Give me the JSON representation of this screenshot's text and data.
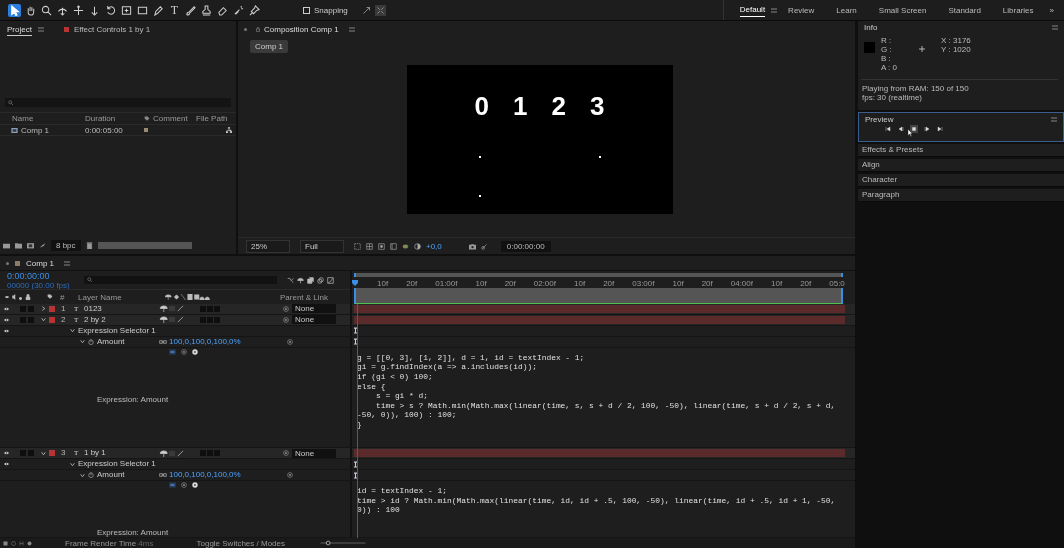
{
  "toolbar": {
    "tools": [
      {
        "kind": "select",
        "selected": true
      },
      {
        "kind": "hand",
        "selected": false
      },
      {
        "kind": "zoom",
        "selected": false
      },
      {
        "kind": "orbit",
        "selected": false
      },
      {
        "kind": "pan",
        "selected": false
      },
      {
        "kind": "dolly",
        "selected": false
      },
      {
        "kind": "rotate",
        "selected": false
      },
      {
        "kind": "behind",
        "selected": false
      },
      {
        "kind": "rect",
        "selected": false
      },
      {
        "kind": "pen",
        "selected": false
      },
      {
        "kind": "type",
        "glyph": "T",
        "selected": false
      },
      {
        "kind": "brush",
        "selected": false
      },
      {
        "kind": "stamp",
        "selected": false
      },
      {
        "kind": "eraser",
        "selected": false
      },
      {
        "kind": "roto",
        "selected": false
      },
      {
        "kind": "puppet",
        "selected": false
      }
    ],
    "snapping": {
      "label": "Snapping",
      "checked": false
    },
    "workspaces": [
      {
        "label": "Default",
        "selected": true
      },
      {
        "label": "Review",
        "selected": false
      },
      {
        "label": "Learn",
        "selected": false
      },
      {
        "label": "Small Screen",
        "selected": false
      },
      {
        "label": "Standard",
        "selected": false
      },
      {
        "label": "Libraries",
        "selected": false
      }
    ],
    "more": "»"
  },
  "project": {
    "tabs": [
      {
        "label": "Project",
        "selected": true
      },
      {
        "label": "Effect Controls 1 by 1",
        "selected": false,
        "color": "#b83434"
      }
    ],
    "columns": [
      "Name",
      "Duration",
      "Comment",
      "File Path"
    ],
    "items": [
      {
        "name": "Comp 1",
        "duration": "0:00:05:00"
      }
    ],
    "bit_depth": "8 bpc",
    "bar": {
      "level": 1
    }
  },
  "composition": {
    "tab": "Composition Comp 1",
    "breadcrumb": "Comp 1",
    "digits": [
      "0",
      "1",
      "2",
      "3"
    ],
    "zoom": "25%",
    "resolution": "Full",
    "exposure": "+0,0",
    "timecode": "0:00:00:00"
  },
  "timeline": {
    "tab": "Comp 1",
    "timecode": "0:00:00:00",
    "frame_info": "00000 (30.00 fps)",
    "columns": {
      "number": "#",
      "layer_name": "Layer Name",
      "parent": "Parent & Link"
    },
    "ruler": [
      "10f",
      "20f",
      "01:00f",
      "10f",
      "20f",
      "02:00f",
      "10f",
      "20f",
      "03:00f",
      "10f",
      "20f",
      "04:00f",
      "10f",
      "20f",
      "05:0"
    ],
    "rows": [
      {
        "kind": "layer",
        "number": "1",
        "glyph": "T",
        "name": "0123",
        "expanded": false,
        "solo": false,
        "locked": false,
        "frame_blend": false,
        "motion_blur": false,
        "adjustment": false,
        "parent": "None",
        "color": "#b83434"
      },
      {
        "kind": "layer",
        "number": "2",
        "glyph": "T",
        "name": "2 by 2",
        "expanded": true,
        "solo": false,
        "locked": false,
        "frame_blend": false,
        "motion_blur": false,
        "adjustment": false,
        "parent": "None",
        "color": "#b83434"
      },
      {
        "kind": "group",
        "name": "Expression Selector 1"
      },
      {
        "kind": "property",
        "name": "Amount",
        "value": "100,0,100,0,100,0%"
      },
      {
        "kind": "expression",
        "label": "Expression: Amount",
        "code": [
          "g = [[0, 3], [1, 2]], d = 1, id = textIndex - 1;",
          "gi = g.findIndex(a => a.includes(id));",
          "if (gi < 0) 100;",
          "else {",
          "    s = gi * d;",
          "    time > s ? Math.min(Math.max(linear(time, s, s + d / 2, 100, -50), linear(time, s + d / 2, s + d,",
          "-50, 0)), 100) : 100;",
          "}"
        ]
      },
      {
        "kind": "layer",
        "number": "3",
        "glyph": "T",
        "name": "1 by 1",
        "expanded": true,
        "solo": false,
        "locked": false,
        "frame_blend": false,
        "motion_blur": false,
        "adjustment": false,
        "parent": "None",
        "color": "#b83434"
      },
      {
        "kind": "group",
        "name": "Expression Selector 1"
      },
      {
        "kind": "property",
        "name": "Amount",
        "value": "100,0,100,0,100,0%"
      },
      {
        "kind": "expression",
        "label": "Expression: Amount",
        "code": [
          "id = textIndex - 1;",
          "time > id ? Math.min(Math.max(linear(time, id, id + .5, 100, -50), linear(time, id + .5, id + 1, -50,",
          "0)) : 100"
        ]
      }
    ],
    "status": {
      "render_label": "Frame Render Time",
      "render_value": "4ms",
      "toggle": "Toggle Switches / Modes",
      "zoom_slider": {
        "level": 0.15
      }
    }
  },
  "info": {
    "title": "Info",
    "channels": [
      "R :",
      "G :",
      "B :",
      "A :  0"
    ],
    "coords": [
      "X : 3176",
      "Y : 1020"
    ],
    "lines": [
      "Playing from RAM: 150 of 150",
      "fps: 30 (realtime)"
    ]
  },
  "preview": {
    "title": "Preview",
    "buttons": [
      {
        "kind": "first",
        "selected": false
      },
      {
        "kind": "prev",
        "selected": false
      },
      {
        "kind": "stop",
        "selected": true
      },
      {
        "kind": "next",
        "selected": false
      },
      {
        "kind": "last",
        "selected": false
      }
    ]
  },
  "panels": [
    "Effects & Presets",
    "Align",
    "Character",
    "Paragraph"
  ]
}
